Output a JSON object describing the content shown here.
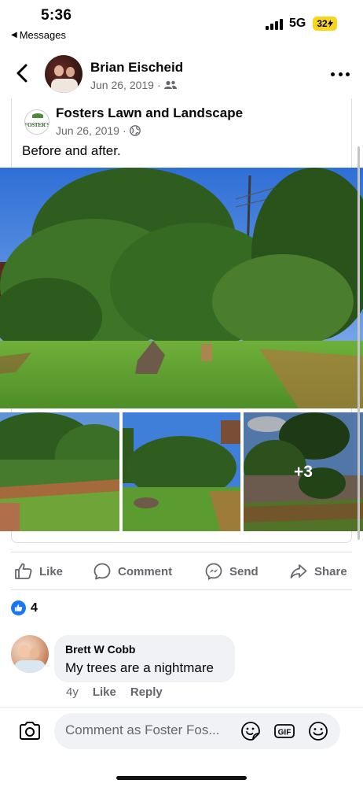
{
  "status_bar": {
    "time": "5:36",
    "back_app": "Messages",
    "network": "5G",
    "battery": "32"
  },
  "post": {
    "author": "Brian Eischeid",
    "date": "Jun 26, 2019",
    "audience_icon": "friends-icon",
    "shared": {
      "page_name": "Fosters Lawn and Landscape",
      "logo_text": "FOSTER'S",
      "date": "Jun 26, 2019",
      "audience_icon": "globe-icon",
      "caption": "Before and after.",
      "more_photos": "+3"
    }
  },
  "actions": {
    "like": "Like",
    "comment": "Comment",
    "send": "Send",
    "share": "Share"
  },
  "reactions": {
    "count": "4",
    "type": "like"
  },
  "comment": {
    "author": "Brett W Cobb",
    "text": "My trees are a nightmare",
    "age": "4y",
    "like": "Like",
    "reply": "Reply"
  },
  "composer": {
    "placeholder": "Comment as Foster Fos...",
    "gif_label": "GIF"
  },
  "colors": {
    "brand_blue": "#1877f2",
    "secondary_text": "#65676b",
    "battery": "#f7d51d"
  }
}
